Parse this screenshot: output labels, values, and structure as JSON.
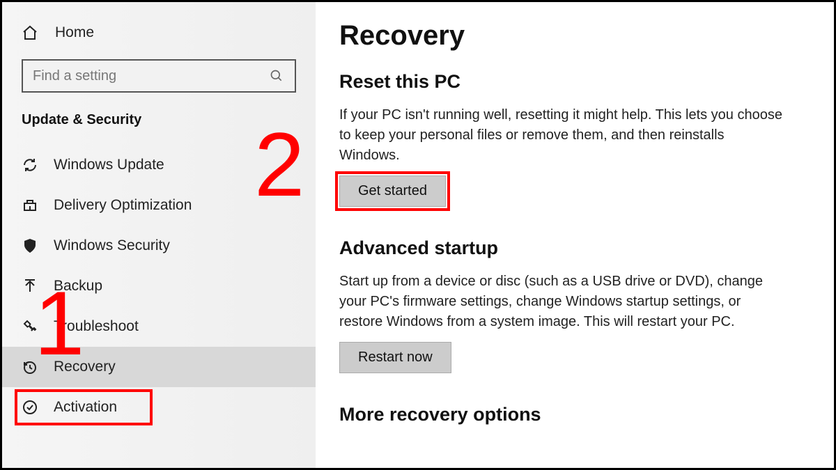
{
  "sidebar": {
    "home_label": "Home",
    "search_placeholder": "Find a setting",
    "category_title": "Update & Security",
    "items": [
      {
        "label": "Windows Update",
        "icon": "sync"
      },
      {
        "label": "Delivery Optimization",
        "icon": "delivery"
      },
      {
        "label": "Windows Security",
        "icon": "shield"
      },
      {
        "label": "Backup",
        "icon": "backup"
      },
      {
        "label": "Troubleshoot",
        "icon": "wrench"
      },
      {
        "label": "Recovery",
        "icon": "recovery"
      },
      {
        "label": "Activation",
        "icon": "check-circle"
      }
    ]
  },
  "main": {
    "page_title": "Recovery",
    "sections": {
      "reset": {
        "title": "Reset this PC",
        "desc": "If your PC isn't running well, resetting it might help. This lets you choose to keep your personal files or remove them, and then reinstalls Windows.",
        "button": "Get started"
      },
      "advanced": {
        "title": "Advanced startup",
        "desc": "Start up from a device or disc (such as a USB drive or DVD), change your PC's firmware settings, change Windows startup settings, or restore Windows from a system image. This will restart your PC.",
        "button": "Restart now"
      },
      "more": {
        "title": "More recovery options"
      }
    }
  },
  "annotations": {
    "num1": "1",
    "num2": "2"
  }
}
